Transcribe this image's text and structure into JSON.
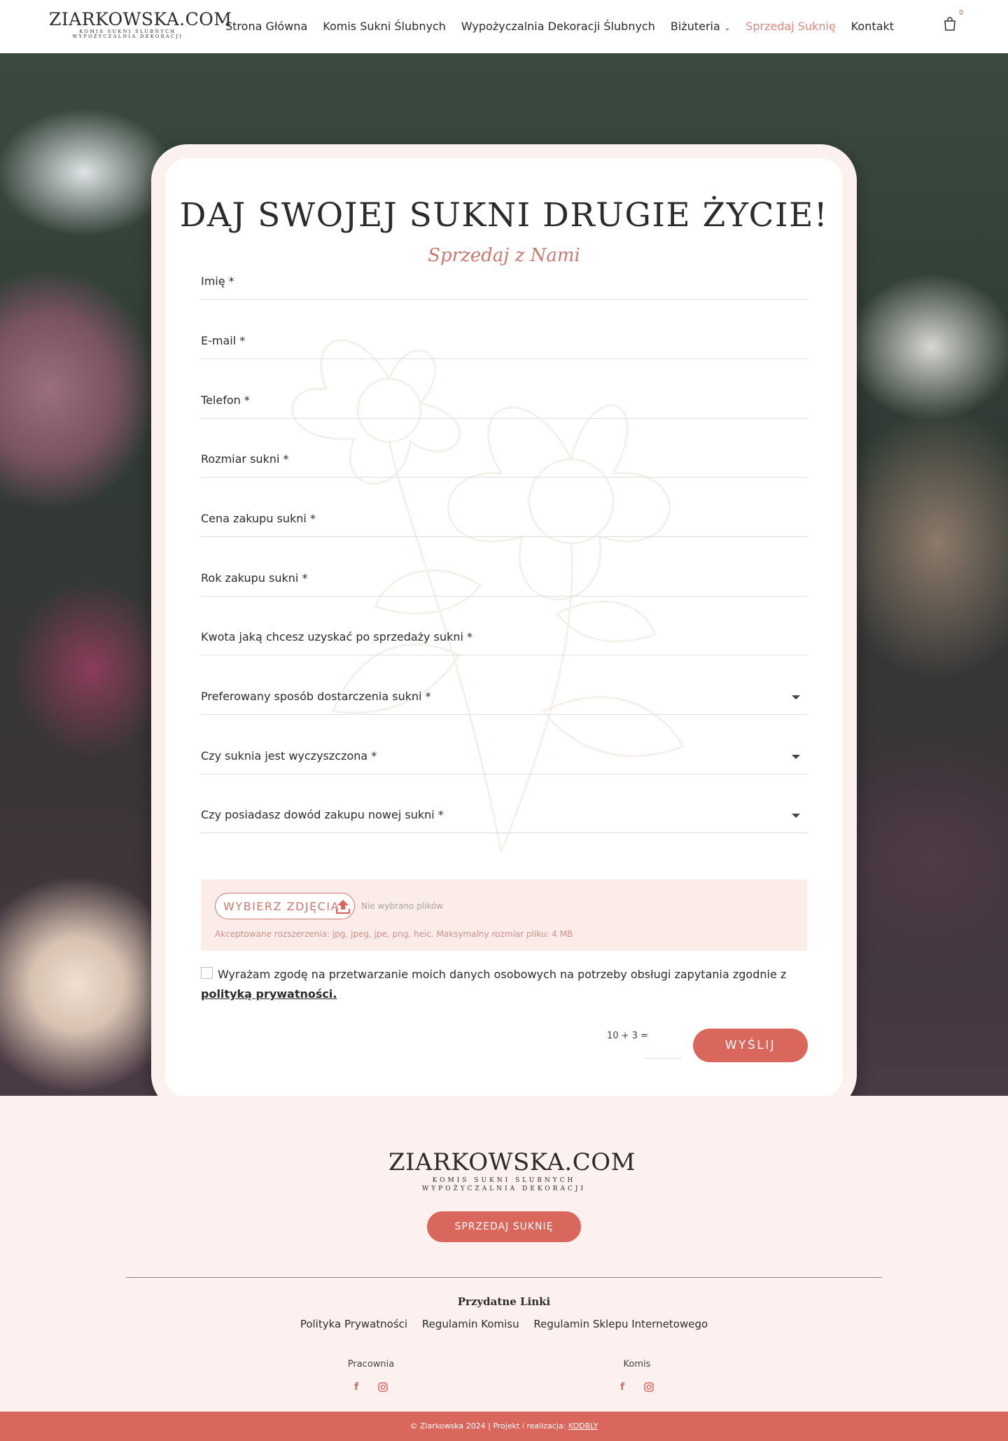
{
  "header": {
    "logo_main": "ZIARKOWSKA.COM",
    "logo_sub1": "KOMIS SUKNI ŚLUBNYCH",
    "logo_sub2": "WYPOŻYCZALNIA DEKORACJI",
    "nav": [
      {
        "label": "Strona Główna"
      },
      {
        "label": "Komis Sukni Ślubnych"
      },
      {
        "label": "Wypożyczalnia Dekoracji Ślubnych"
      },
      {
        "label": "Biżuteria"
      },
      {
        "label": "Sprzedaj Suknię"
      },
      {
        "label": "Kontakt"
      }
    ],
    "cart_count": "0",
    "cart_icon": "shopping-bag-icon"
  },
  "form": {
    "title": "DAJ SWOJEJ SUKNI DRUGIE ŻYCIE!",
    "subtitle": "Sprzedaj z Nami",
    "fields": [
      {
        "label": "Imię *"
      },
      {
        "label": "E-mail *"
      },
      {
        "label": "Telefon *"
      },
      {
        "label": "Rozmiar sukni *"
      },
      {
        "label": "Cena zakupu sukni *"
      },
      {
        "label": "Rok zakupu sukni *"
      },
      {
        "label": "Kwota jaką chcesz uzyskać po sprzedaży sukni *"
      },
      {
        "label": "Preferowany sposób dostarczenia sukni *"
      },
      {
        "label": "Czy suknia jest wyczyszczona *"
      },
      {
        "label": "Czy posiadasz dowód zakupu nowej sukni *"
      }
    ],
    "upload_button": "WYBIERZ ZDJĘCIA",
    "upload_status": "Nie wybrano plików",
    "upload_accepted": "Akceptowane rozszerzenia: jpg, jpeg, jpe, png, heic. Maksymalny rozmiar pliku: 4 MB",
    "consent_text": "Wyrażam zgodę na przetwarzanie moich danych osobowych na potrzeby obsługi zapytania zgodnie z",
    "consent_link": "polityką prywatności.",
    "captcha": "10 + 3 =",
    "submit": "WYŚLIJ"
  },
  "footer": {
    "logo_main": "ZIARKOWSKA.COM",
    "logo_sub1": "KOMIS SUKNI ŚLUBNYCH",
    "logo_sub2": "WYPOŻYCZALNIA DEKORACJI",
    "button": "SPRZEDAJ SUKNIĘ",
    "useful_title": "Przydatne Linki",
    "links": [
      "Polityka Prywatności",
      "Regulamin Komisu",
      "Regulamin Sklepu Internetowego"
    ],
    "loc1": "Pracownia",
    "loc2": "Komis",
    "copyright": "© Ziarkowska 2024 | Projekt i realizacja:",
    "credit": "KODBLY"
  },
  "colors": {
    "accent": "#d9675c",
    "accent_light": "#c97b72",
    "background": "#fcf1ef"
  }
}
